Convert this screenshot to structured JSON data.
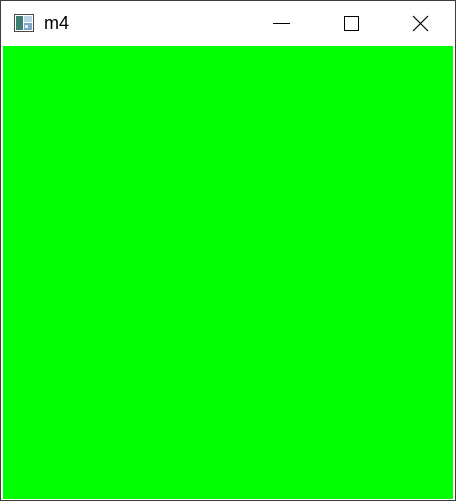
{
  "window": {
    "title": "m4",
    "client_color": "#00ff00"
  },
  "titlebar": {
    "icons": {
      "app": "app-window-icon",
      "minimize": "minimize-icon",
      "maximize": "maximize-icon",
      "close": "close-icon"
    }
  }
}
